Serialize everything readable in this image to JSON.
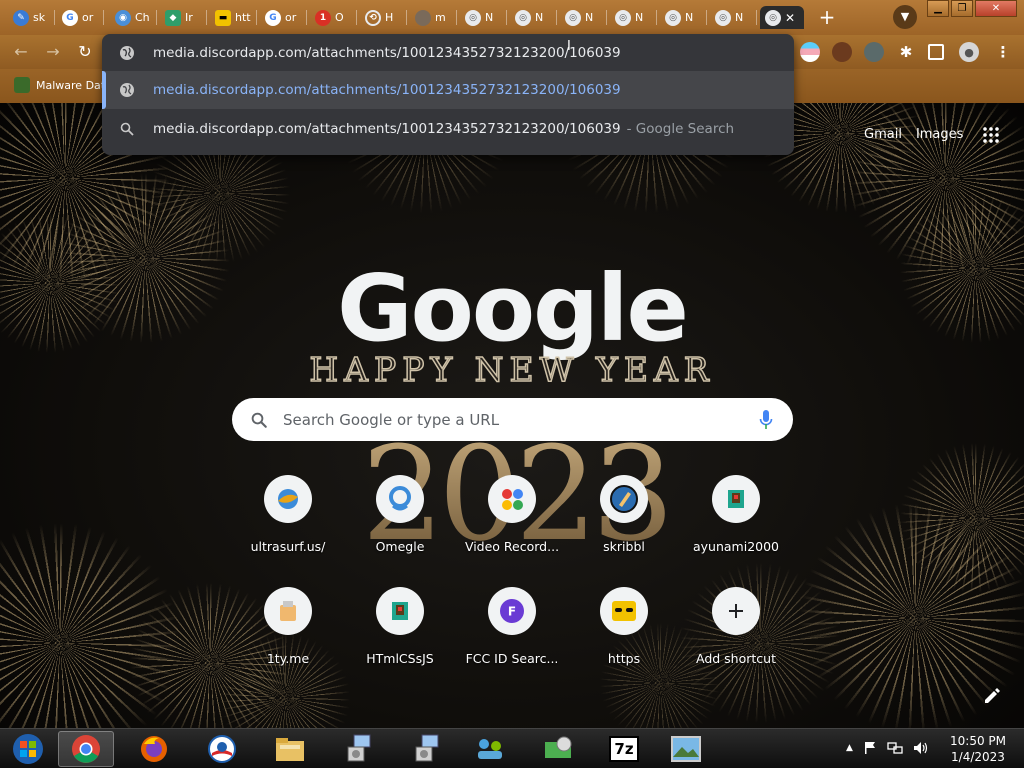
{
  "browser": {
    "tabs": [
      {
        "label": "sk",
        "icon": "pen-icon",
        "color": "#3a7bd5"
      },
      {
        "label": "or",
        "icon": "google-icon",
        "color": "#ffffff"
      },
      {
        "label": "Ch",
        "icon": "chat-icon",
        "color": "#4a8fd8"
      },
      {
        "label": "Ir",
        "icon": "app-icon",
        "color": "#2f9e6a"
      },
      {
        "label": "htt",
        "icon": "mask-icon",
        "color": "#f2c200"
      },
      {
        "label": "or",
        "icon": "google-icon",
        "color": "#ffffff"
      },
      {
        "label": "O",
        "icon": "notification-icon",
        "color": "#d93025"
      },
      {
        "label": "H",
        "icon": "history-icon",
        "color": "#e8eaed"
      },
      {
        "label": "m",
        "icon": "avatar-icon",
        "color": "#7a6a5a"
      },
      {
        "label": "N",
        "icon": "chromium-icon",
        "color": "#e8eaed"
      },
      {
        "label": "N",
        "icon": "chromium-icon",
        "color": "#e8eaed"
      },
      {
        "label": "N",
        "icon": "chromium-icon",
        "color": "#e8eaed"
      },
      {
        "label": "N",
        "icon": "chromium-icon",
        "color": "#e8eaed"
      },
      {
        "label": "N",
        "icon": "chromium-icon",
        "color": "#e8eaed"
      },
      {
        "label": "N",
        "icon": "chromium-icon",
        "color": "#e8eaed"
      }
    ],
    "active_tab_close": "✕",
    "new_tab": "+",
    "bookmark": {
      "label": "Malware Dat"
    }
  },
  "omnibox": {
    "input": "media.discordapp.com/attachments/1001234352732123200/106039",
    "suggestions": [
      {
        "text": "media.discordapp.com/attachments/1001234352732123200/106039",
        "suffix": "",
        "icon": "globe-icon",
        "selected": true
      },
      {
        "text": "media.discordapp.com/attachments/1001234352732123200/106039",
        "suffix": "- Google Search",
        "icon": "search-icon",
        "selected": false
      }
    ]
  },
  "ntp": {
    "gmail": "Gmail",
    "images": "Images",
    "logo": "Google",
    "doodle_line": "HAPPY NEW YEAR",
    "doodle_year": "2023",
    "search_placeholder": "Search Google or type a URL",
    "shortcuts": [
      {
        "label": "ultrasurf.us/",
        "icon": "ultrasurf-icon",
        "color": "#e8a317"
      },
      {
        "label": "Omegle",
        "icon": "omegle-icon",
        "color": "#3b8bd9"
      },
      {
        "label": "Video Record...",
        "icon": "video-record-icon",
        "color": "#e53935"
      },
      {
        "label": "skribbl",
        "icon": "skribbl-icon",
        "color": "#2b6cb0"
      },
      {
        "label": "ayunami2000",
        "icon": "ayunami-icon",
        "color": "#1fa58e"
      },
      {
        "label": "1ty.me",
        "icon": "1ty-icon",
        "color": "#f0b86e"
      },
      {
        "label": "HTmlCSsJS",
        "icon": "htmlcssjs-icon",
        "color": "#1fa58e"
      },
      {
        "label": "FCC ID Searc...",
        "icon": "fcc-icon",
        "color": "#6a3bd4"
      },
      {
        "label": "https",
        "icon": "mask-icon",
        "color": "#f2c200"
      },
      {
        "label": "Add shortcut",
        "icon": "plus-icon",
        "color": "#202124"
      }
    ]
  },
  "taskbar": {
    "apps": [
      {
        "name": "start-orb",
        "icon": "windows-orb-icon"
      },
      {
        "name": "chrome",
        "icon": "chrome-icon"
      },
      {
        "name": "firefox",
        "icon": "firefox-icon"
      },
      {
        "name": "obama",
        "icon": "obama-logo-icon"
      },
      {
        "name": "explorer",
        "icon": "folder-icon"
      },
      {
        "name": "installer-1",
        "icon": "installer-icon"
      },
      {
        "name": "installer-2",
        "icon": "installer-icon"
      },
      {
        "name": "network",
        "icon": "network-icon"
      },
      {
        "name": "disk",
        "icon": "disk-icon"
      },
      {
        "name": "7zip",
        "icon": "7zip-icon"
      },
      {
        "name": "picture",
        "icon": "picture-icon"
      }
    ],
    "zip_label": "7z",
    "time": "10:50 PM",
    "date": "1/4/2023",
    "tray_chevron": "▲"
  }
}
